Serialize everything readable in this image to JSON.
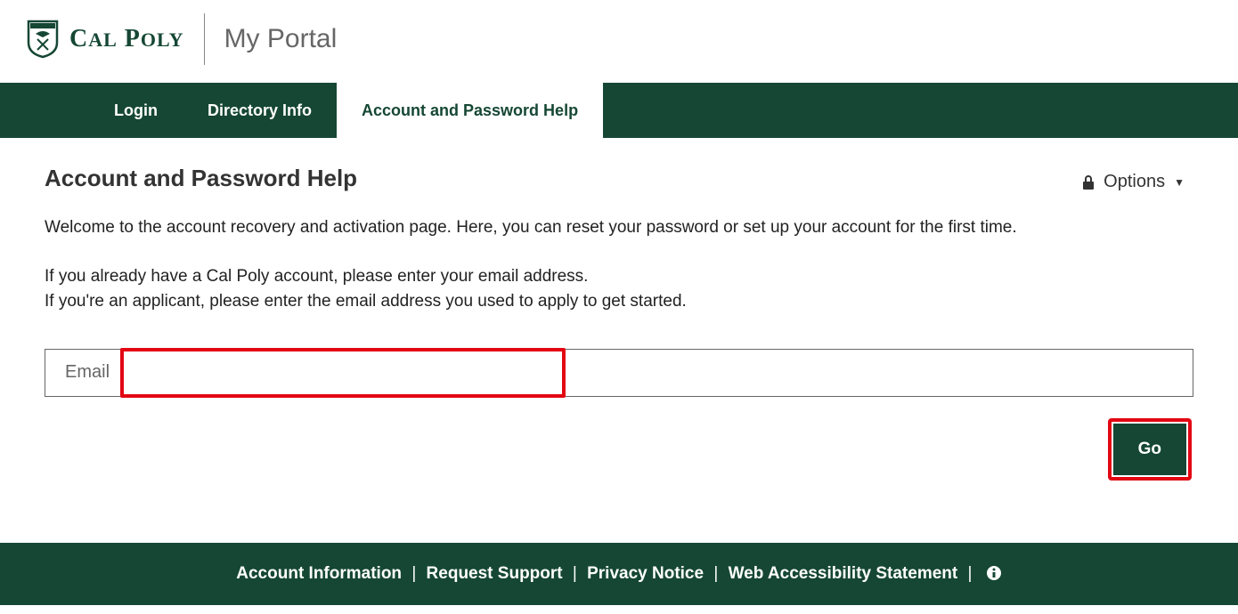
{
  "header": {
    "brand": "CAL POLY",
    "portal": "My Portal"
  },
  "nav": {
    "tabs": [
      {
        "label": "Login",
        "active": false
      },
      {
        "label": "Directory Info",
        "active": false
      },
      {
        "label": "Account and Password Help",
        "active": true
      }
    ]
  },
  "options": {
    "label": "Options"
  },
  "page": {
    "title": "Account and Password Help",
    "intro": "Welcome to the account recovery and activation page. Here, you can reset your password or set up your account for the first time.",
    "instruction1": "If you already have a Cal Poly account, please enter your email address.",
    "instruction2": "If you're an applicant, please enter the email address you used to apply to get started.",
    "email_label": "Email",
    "email_value": "",
    "go_label": "Go"
  },
  "footer": {
    "links": [
      "Account Information",
      "Request Support",
      "Privacy Notice",
      "Web Accessibility Statement"
    ]
  }
}
